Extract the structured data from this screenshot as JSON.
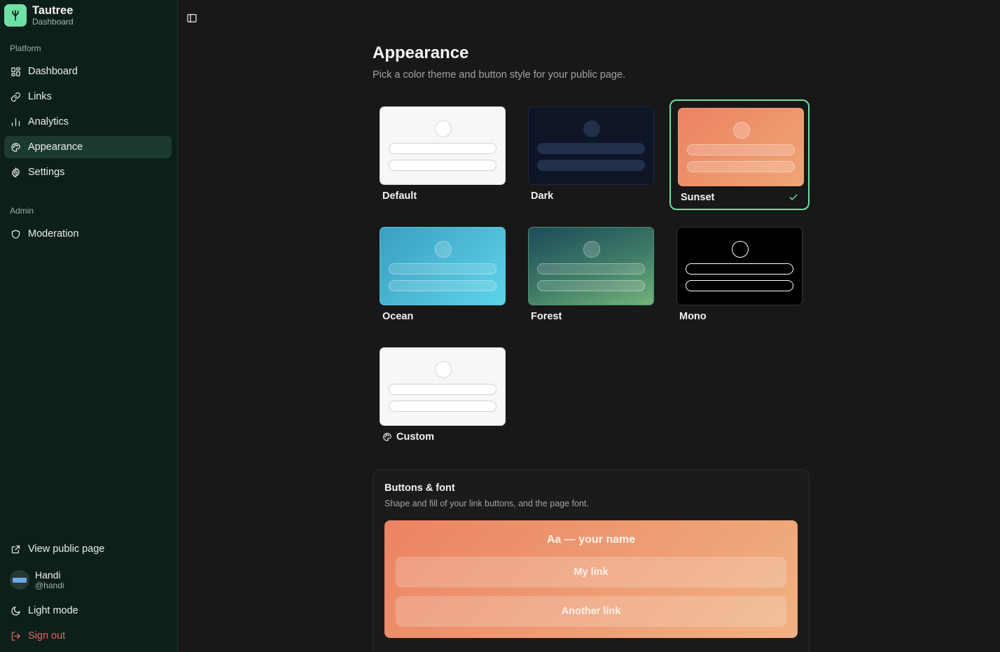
{
  "app": {
    "name": "Tautree",
    "subtitle": "Dashboard"
  },
  "sidebar": {
    "sections": [
      {
        "label": "Platform",
        "items": [
          {
            "label": "Dashboard",
            "icon": "grid-icon",
            "active": false
          },
          {
            "label": "Links",
            "icon": "link-icon",
            "active": false
          },
          {
            "label": "Analytics",
            "icon": "bar-chart-icon",
            "active": false
          },
          {
            "label": "Appearance",
            "icon": "palette-icon",
            "active": true
          },
          {
            "label": "Settings",
            "icon": "gear-icon",
            "active": false
          }
        ]
      },
      {
        "label": "Admin",
        "items": [
          {
            "label": "Moderation",
            "icon": "shield-icon",
            "active": false
          }
        ]
      }
    ],
    "footer": {
      "view_public": "View public page",
      "user": {
        "name": "Handi",
        "handle": "@handi"
      },
      "light_mode": "Light mode",
      "sign_out": "Sign out"
    }
  },
  "main": {
    "title": "Appearance",
    "subtitle": "Pick a color theme and button style for your public page.",
    "themes": [
      {
        "label": "Default",
        "selected": false
      },
      {
        "label": "Dark",
        "selected": false
      },
      {
        "label": "Sunset",
        "selected": true
      },
      {
        "label": "Ocean",
        "selected": false
      },
      {
        "label": "Forest",
        "selected": false
      },
      {
        "label": "Mono",
        "selected": false
      },
      {
        "label": "Custom",
        "selected": false
      }
    ],
    "buttons_font": {
      "title": "Buttons & font",
      "subtitle": "Shape and fill of your link buttons, and the page font.",
      "preview_name": "Aa — your name",
      "preview_links": [
        "My link",
        "Another link"
      ]
    }
  },
  "colors": {
    "accent": "#6fe1a6",
    "sidebar_bg": "#0d1f19",
    "active_bg": "#1c3a2e",
    "danger": "#e86868"
  }
}
